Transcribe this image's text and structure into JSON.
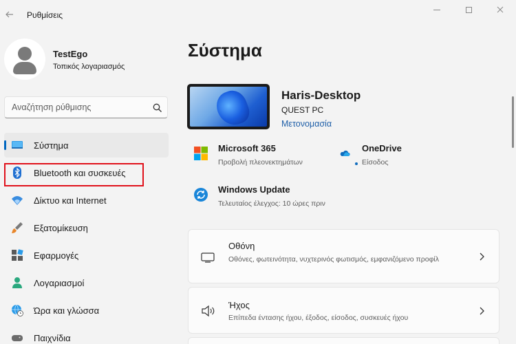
{
  "window": {
    "title": "Ρυθμίσεις",
    "back_icon": "arrow-left-icon"
  },
  "profile": {
    "name": "TestEgo",
    "account_type": "Τοπικός λογαριασμός"
  },
  "search": {
    "placeholder": "Αναζήτηση ρύθμισης"
  },
  "sidebar": {
    "items": [
      {
        "label": "Σύστημα",
        "icon": "system-icon",
        "active": true
      },
      {
        "label": "Bluetooth και συσκευές",
        "icon": "bluetooth-icon",
        "active": false,
        "highlighted": true
      },
      {
        "label": "Δίκτυο και Internet",
        "icon": "wifi-icon",
        "active": false
      },
      {
        "label": "Εξατομίκευση",
        "icon": "brush-icon",
        "active": false
      },
      {
        "label": "Εφαρμογές",
        "icon": "apps-icon",
        "active": false
      },
      {
        "label": "Λογαριασμοί",
        "icon": "account-icon",
        "active": false
      },
      {
        "label": "Ώρα και γλώσσα",
        "icon": "globe-clock-icon",
        "active": false
      },
      {
        "label": "Παιχνίδια",
        "icon": "gamepad-icon",
        "active": false
      }
    ]
  },
  "main": {
    "title": "Σύστημα",
    "device": {
      "name": "Haris-Desktop",
      "model": "QUEST PC",
      "rename_link": "Μετονομασία"
    },
    "quick_links": [
      {
        "title": "Microsoft 365",
        "subtitle": "Προβολή πλεονεκτημάτων",
        "icon": "microsoft-365-icon"
      },
      {
        "title": "OneDrive",
        "subtitle": "Είσοδος",
        "icon": "onedrive-icon",
        "status_dot": true
      },
      {
        "title": "Windows Update",
        "subtitle": "Τελευταίος έλεγχος: 10 ώρες πριν",
        "icon": "windows-update-icon"
      }
    ],
    "cards": [
      {
        "title": "Οθόνη",
        "description": "Οθόνες, φωτεινότητα, νυχτερινός φωτισμός, εμφανιζόμενο προφίλ",
        "icon": "monitor-icon"
      },
      {
        "title": "Ήχος",
        "description": "Επίπεδα έντασης ήχου, έξοδος, είσοδος, συσκευές ήχου",
        "icon": "speaker-icon"
      }
    ]
  },
  "colors": {
    "accent": "#0067c0",
    "highlight_border": "#e0101a",
    "background": "#f3f3f3"
  }
}
